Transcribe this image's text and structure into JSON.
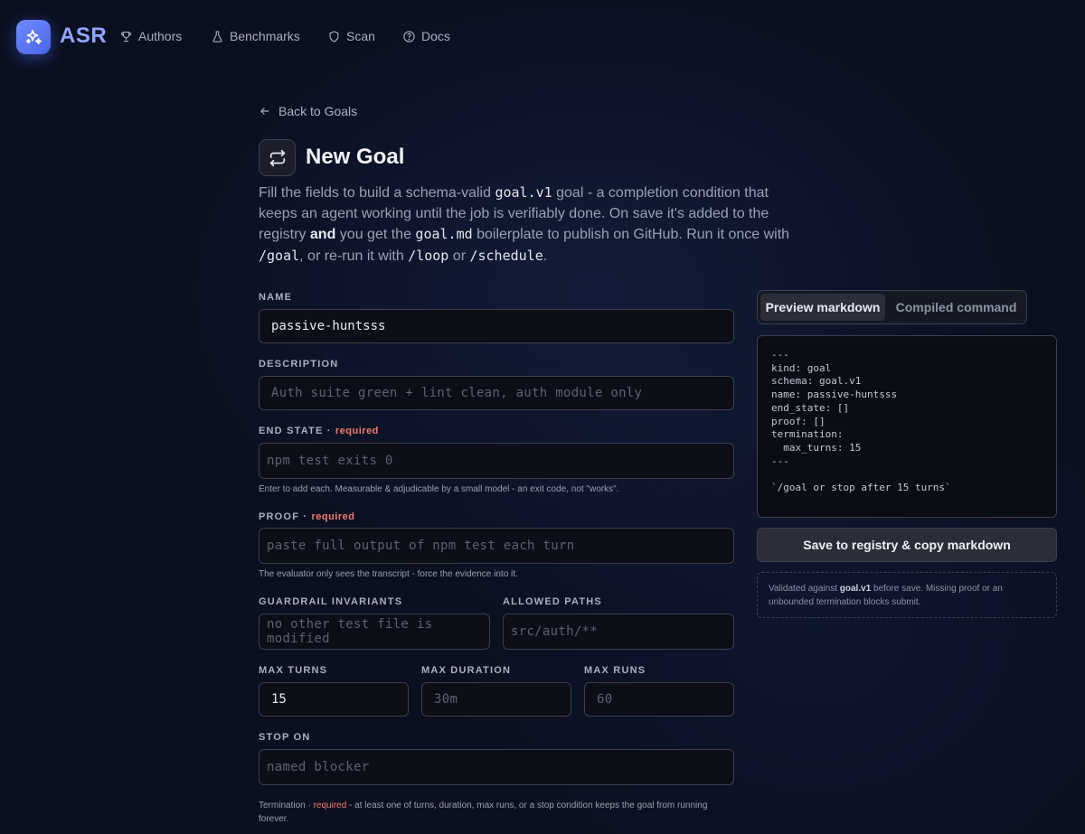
{
  "header": {
    "brand": "ASR",
    "nav": [
      {
        "label": "Authors",
        "icon": "trophy-icon"
      },
      {
        "label": "Benchmarks",
        "icon": "flask-icon"
      },
      {
        "label": "Scan",
        "icon": "shield-icon"
      },
      {
        "label": "Docs",
        "icon": "help-circle-icon"
      }
    ]
  },
  "back_link": "Back to Goals",
  "page_title": "New Goal",
  "intro": {
    "p1": "Fill the fields to build a schema-valid ",
    "c1": "goal.v1",
    "p2": " goal - a completion condition that keeps an agent working until the job is verifiably done. On save it's added to the registry ",
    "b1": "and",
    "p3": " you get the ",
    "c2": "goal.md",
    "p4": " boilerplate to publish on GitHub. Run it once with ",
    "c3": "/goal",
    "p5": ", or re-run it with ",
    "c4": "/loop",
    "p6": " or ",
    "c5": "/schedule",
    "p7": "."
  },
  "form": {
    "name": {
      "label": "NAME",
      "value": "passive-huntsss"
    },
    "description": {
      "label": "DESCRIPTION",
      "placeholder": "Auth suite green + lint clean, auth module only"
    },
    "end_state": {
      "label": "END STATE · ",
      "required": "required",
      "placeholder": "npm test exits 0",
      "hint": "Enter to add each. Measurable & adjudicable by a small model - an exit code, not \"works\"."
    },
    "proof": {
      "label": "PROOF · ",
      "required": "required",
      "placeholder": "paste full output of npm test each turn",
      "hint": "The evaluator only sees the transcript - force the evidence into it."
    },
    "guardrail": {
      "label": "GUARDRAIL INVARIANTS",
      "placeholder": "no other test file is modified"
    },
    "allowed_paths": {
      "label": "ALLOWED PATHS",
      "placeholder": "src/auth/**"
    },
    "max_turns": {
      "label": "MAX TURNS",
      "value": "15"
    },
    "max_duration": {
      "label": "MAX DURATION",
      "placeholder": "30m"
    },
    "max_runs": {
      "label": "MAX RUNS",
      "placeholder": "60"
    },
    "stop_on": {
      "label": "STOP ON",
      "placeholder": "named blocker"
    },
    "termination_hint": {
      "prefix": "Termination · ",
      "required": "required",
      "text": " - at least one of turns, duration, max runs, or a stop condition keeps the goal from running forever."
    }
  },
  "panel": {
    "tabs": [
      {
        "label": "Preview markdown",
        "active": true
      },
      {
        "label": "Compiled command",
        "active": false
      }
    ],
    "preview": "---\nkind: goal\nschema: goal.v1\nname: passive-huntsss\nend_state: []\nproof: []\ntermination:\n  max_turns: 15\n---\n\n`/goal or stop after 15 turns`",
    "save_button": "Save to registry & copy markdown",
    "note": {
      "p1": "Validated against ",
      "b1": "goal.v1",
      "p2": " before save. Missing proof or an unbounded termination blocks submit."
    }
  },
  "colors": {
    "background": "#0b1020",
    "accent": "#6f8dff",
    "required": "#f07a6a"
  }
}
